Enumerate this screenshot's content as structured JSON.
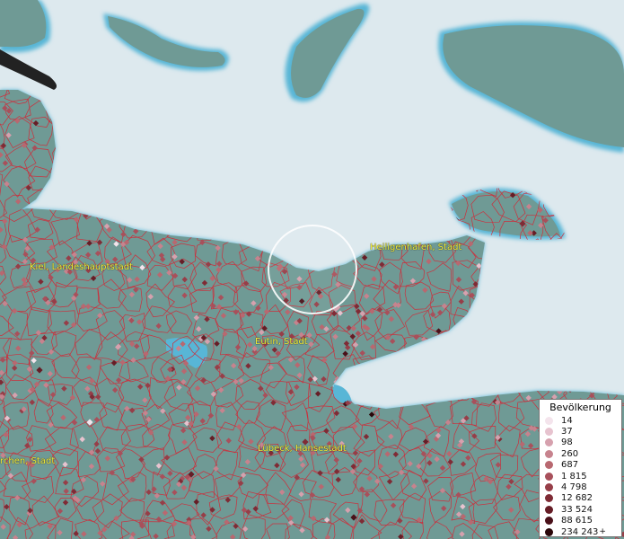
{
  "map": {
    "places": [
      {
        "id": "kiel",
        "label": "Kiel, Landeshauptstadt"
      },
      {
        "id": "heiligenhafen",
        "label": "Heiligenhafen, Stadt"
      },
      {
        "id": "eutin",
        "label": "Eutin, Stadt"
      },
      {
        "id": "luebeck",
        "label": "Lübeck, Hansestadt"
      },
      {
        "id": "neumuenster",
        "label": "rchen, Stadt"
      }
    ]
  },
  "legend": {
    "title": "Bevölkerung",
    "classes": [
      {
        "label": "14",
        "color": "#f4e4ec"
      },
      {
        "label": "37",
        "color": "#e7c3cf"
      },
      {
        "label": "98",
        "color": "#d6a1ae"
      },
      {
        "label": "260",
        "color": "#c7838e"
      },
      {
        "label": "687",
        "color": "#b86870"
      },
      {
        "label": "1 815",
        "color": "#a8505b"
      },
      {
        "label": "4 798",
        "color": "#963e48"
      },
      {
        "label": "12 682",
        "color": "#7f2b35"
      },
      {
        "label": "33 524",
        "color": "#661d26"
      },
      {
        "label": "88 615",
        "color": "#4a1019"
      },
      {
        "label": "234 243",
        "color": "#2a0609",
        "suffix": "+"
      }
    ]
  },
  "colors": {
    "sea": "#dde9ee",
    "land": "#6f9a95",
    "coast": "#58b6d6",
    "boundary": "#cc2f3c",
    "label": "#f0ee3a"
  }
}
